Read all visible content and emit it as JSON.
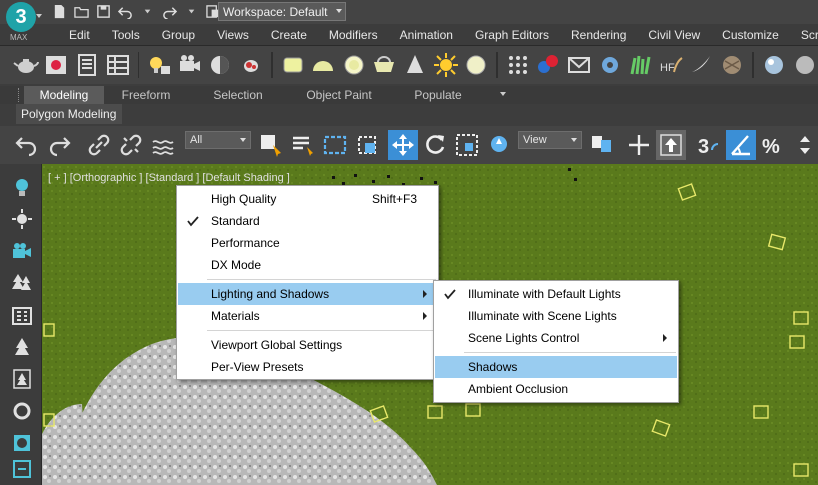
{
  "app": {
    "logo_text": "3",
    "logo_sub": "MAX",
    "workspace_label": "Workspace: Default"
  },
  "menubar": {
    "items": [
      "Edit",
      "Tools",
      "Group",
      "Views",
      "Create",
      "Modifiers",
      "Animation",
      "Graph Editors",
      "Rendering",
      "Civil View",
      "Customize",
      "Scri"
    ]
  },
  "ribbon": {
    "tabs": [
      "Modeling",
      "Freeform",
      "Selection",
      "Object Paint",
      "Populate"
    ],
    "active_tab": "Modeling",
    "panel_label": "Polygon Modeling"
  },
  "scene_toolbar": {
    "filter_value": "All",
    "ref_coord_value": "View"
  },
  "viewport": {
    "label": "[ + ] [Orthographic ] [Standard ] [Default Shading ]"
  },
  "shading_menu": {
    "items": [
      {
        "label": "High Quality",
        "shortcut": "Shift+F3"
      },
      {
        "label": "Standard",
        "checked": true
      },
      {
        "label": "Performance"
      },
      {
        "label": "DX Mode"
      },
      {
        "label": "Lighting and Shadows",
        "submenu": true,
        "highlighted": true
      },
      {
        "label": "Materials",
        "submenu": true
      },
      {
        "label": "Viewport Global Settings"
      },
      {
        "label": "Per-View Presets"
      }
    ]
  },
  "lighting_submenu": {
    "items": [
      {
        "label": "Illuminate with Default Lights",
        "checked": true
      },
      {
        "label": "Illuminate with Scene Lights"
      },
      {
        "label": "Scene Lights Control",
        "submenu": true
      },
      {
        "label": "Shadows",
        "highlighted": true
      },
      {
        "label": "Ambient Occlusion"
      }
    ]
  },
  "colors": {
    "menu_highlight": "#99ccf0",
    "ground": "#5a7a1c",
    "ui_bg": "#444444",
    "accent_blue": "#3b8fd6"
  }
}
